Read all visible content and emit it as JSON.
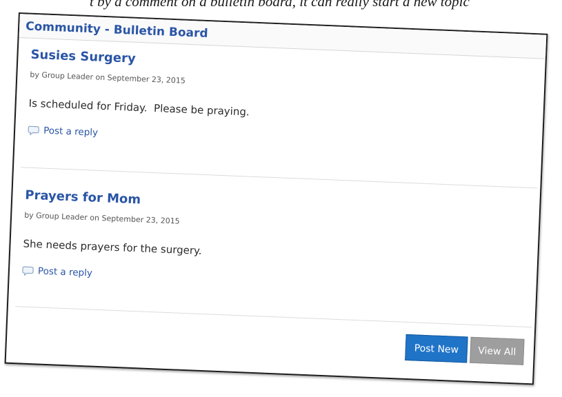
{
  "caption_fragment": "t by a comment on a bulletin board, it can really start a new topic",
  "board": {
    "title": "Community - Bulletin Board"
  },
  "posts": [
    {
      "title": "Susies Surgery",
      "meta": "by Group Leader on September 23, 2015",
      "body": "Is scheduled for Friday.  Please be praying.",
      "reply_label": "Post a reply"
    },
    {
      "title": "Prayers for Mom",
      "meta": "by Group Leader on September 23, 2015",
      "body": "She needs prayers for the surgery.",
      "reply_label": "Post a reply"
    }
  ],
  "actions": {
    "post_new_label": "Post New",
    "view_all_label": "View All"
  },
  "icons": {
    "reply": "speech-bubble-icon"
  },
  "colors": {
    "link_blue": "#2a55a6",
    "primary_button": "#1f74c8",
    "secondary_button": "#9e9e9e"
  }
}
